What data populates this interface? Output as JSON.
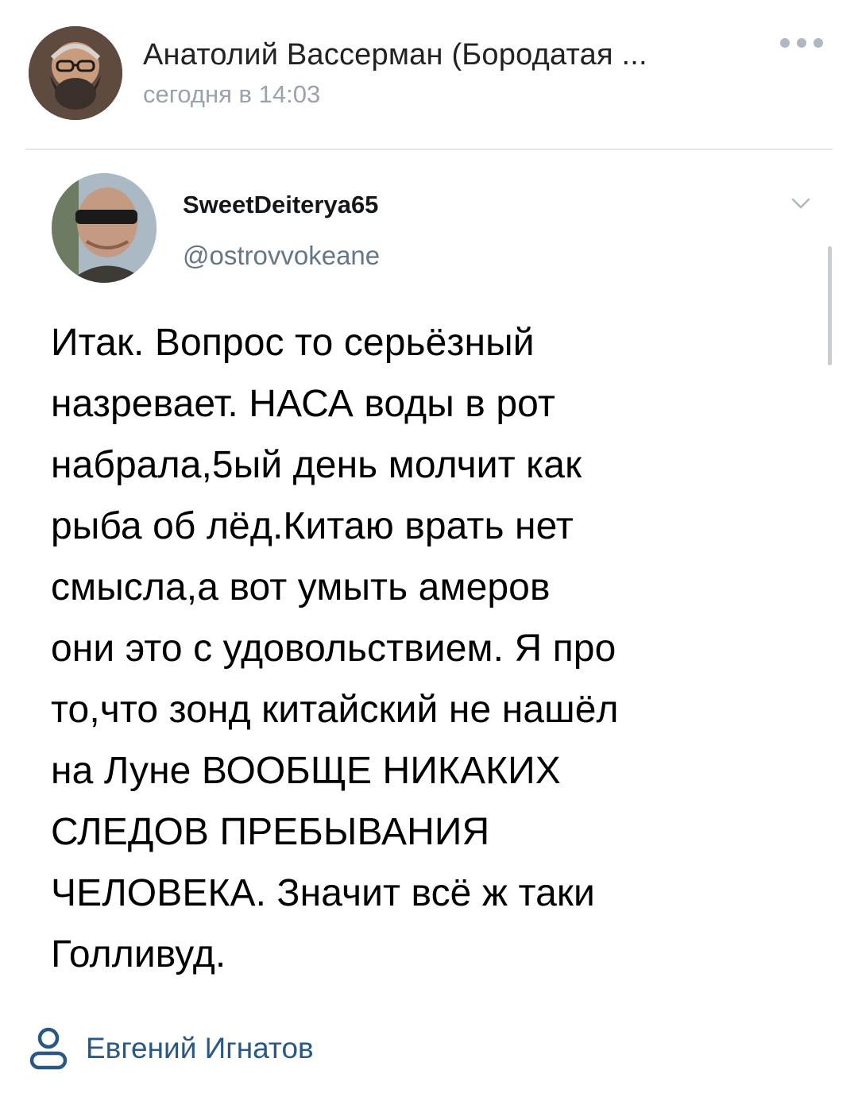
{
  "post": {
    "author_name": "Анатолий Вассерман (Бородатая ...",
    "time": "сегодня в 14:03",
    "more_icon": "more-dots-icon"
  },
  "tweet": {
    "display_name": "SweetDeiterya65",
    "handle": "@ostrovvokeane",
    "text": "Итак. Вопрос то серьёзный\nназревает. НАСА воды в рот\nнабрала,5ый день молчит как\nрыба об лёд.Китаю врать нет\nсмысла,а вот умыть амеров\nони это с удовольствием. Я про\nто,что зонд китайский не нашёл\nна Луне ВООБЩЕ НИКАКИХ\nСЛЕДОВ ПРЕБЫВАНИЯ\nЧЕЛОВЕКА. Значит всё ж таки\nГолливуд."
  },
  "source": {
    "name": "Евгений Игнатов",
    "icon": "person-icon"
  },
  "colors": {
    "link": "#2a5885",
    "muted": "#9aa3ad",
    "handle": "#657786",
    "divider": "#e7e8ec"
  }
}
